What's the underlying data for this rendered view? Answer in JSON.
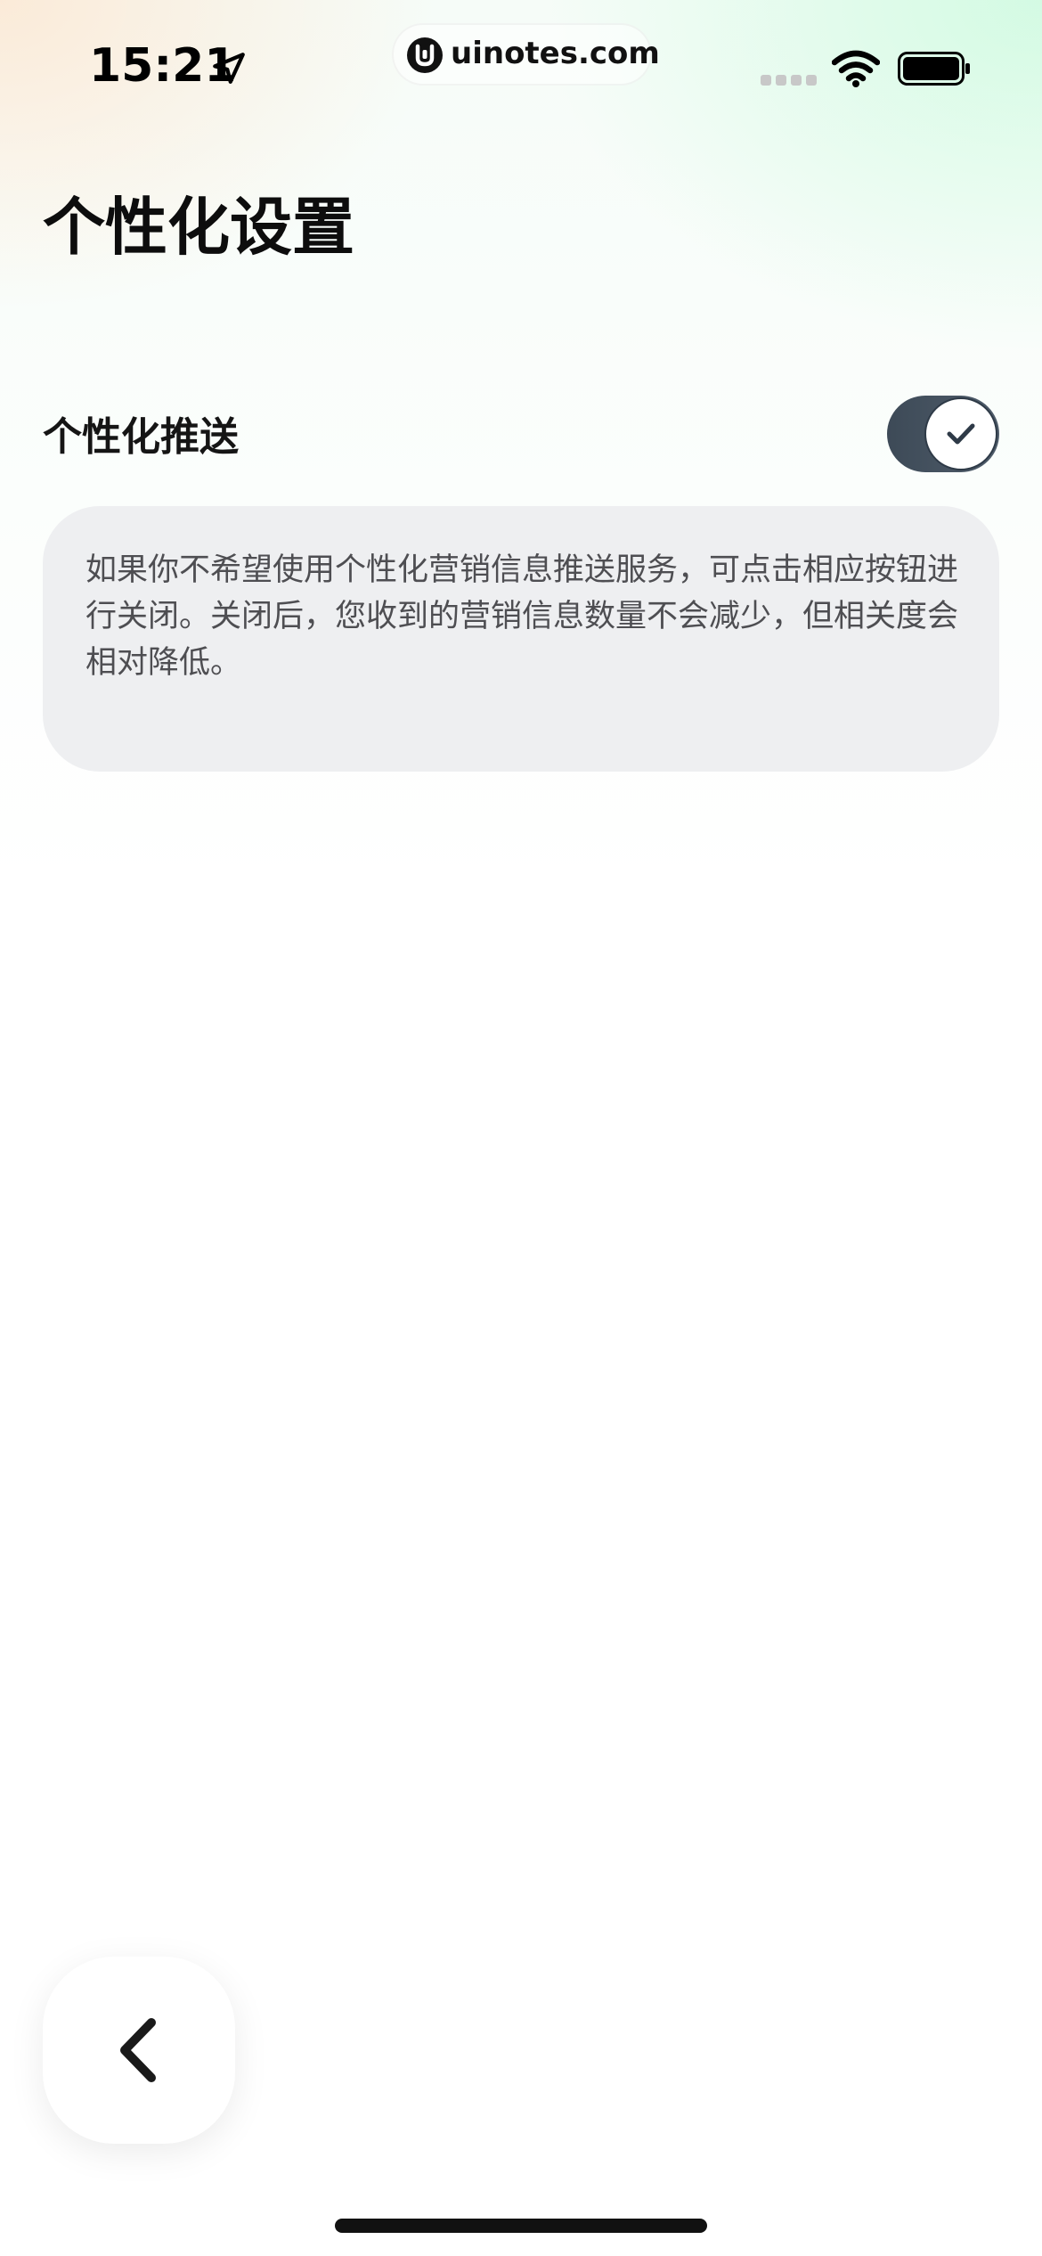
{
  "status_bar": {
    "time": "15:21",
    "url": "uinotes.com",
    "icons": {
      "location": "location-arrow-icon",
      "logo": "uinotes-logo-icon",
      "signal": "cellular-signal-icon",
      "wifi": "wifi-icon",
      "battery": "battery-icon"
    }
  },
  "page": {
    "title": "个性化设置"
  },
  "setting": {
    "label": "个性化推送",
    "toggle_on": true,
    "description": "如果你不希望使用个性化营销信息推送服务，可点击相应按钮进行关闭。关闭后，您收到的营销信息数量不会减少，但相关度会相对降低。"
  },
  "navigation": {
    "back_icon": "chevron-left-icon"
  },
  "colors": {
    "toggle_track": "#3d4a57",
    "card_background": "#eeeff1",
    "description_text": "#4e4e52"
  }
}
